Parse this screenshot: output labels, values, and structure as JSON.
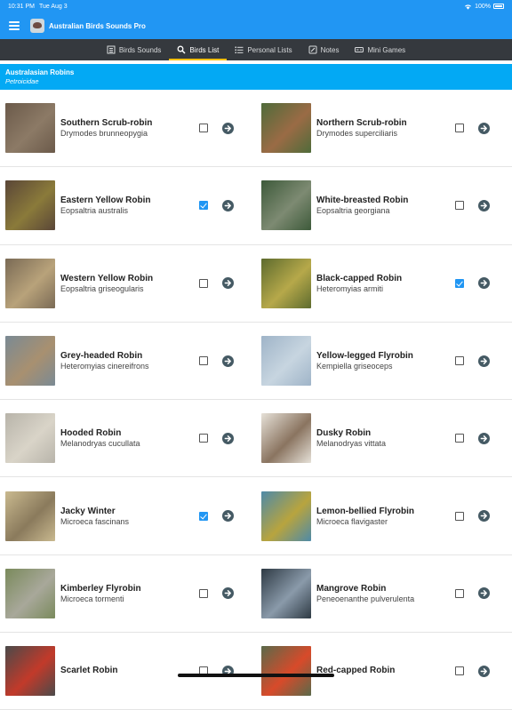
{
  "status_bar": {
    "time": "10:31 PM",
    "date": "Tue Aug 3",
    "battery": "100%"
  },
  "app": {
    "title": "Australian Birds Sounds Pro"
  },
  "tabs": [
    {
      "label": "Birds Sounds",
      "icon": "speaker-icon"
    },
    {
      "label": "Birds List",
      "icon": "search-icon",
      "active": true
    },
    {
      "label": "Personal Lists",
      "icon": "list-icon"
    },
    {
      "label": "Notes",
      "icon": "notes-icon"
    },
    {
      "label": "Mini Games",
      "icon": "gamepad-icon"
    }
  ],
  "section": {
    "family": "Australasian Robins",
    "latin": "Petroicidae"
  },
  "birds": [
    {
      "common": "Southern Scrub-robin",
      "species": "Drymodes brunneopygia",
      "checked": false,
      "photo": [
        "#6b5a4a",
        "#8c7a66"
      ]
    },
    {
      "common": "Northern Scrub-robin",
      "species": "Drymodes superciliaris",
      "checked": false,
      "photo": [
        "#4f6b3a",
        "#9a6b45"
      ]
    },
    {
      "common": "Eastern Yellow Robin",
      "species": "Eopsaltria australis",
      "checked": true,
      "photo": [
        "#5a4638",
        "#8a7a3a"
      ]
    },
    {
      "common": "White-breasted Robin",
      "species": "Eopsaltria georgiana",
      "checked": false,
      "photo": [
        "#3d5a3a",
        "#7d8a72"
      ]
    },
    {
      "common": "Western Yellow Robin",
      "species": "Eopsaltria griseogularis",
      "checked": false,
      "photo": [
        "#7a6a55",
        "#b8a27a"
      ]
    },
    {
      "common": "Black-capped Robin",
      "species": "Heteromyias armiti",
      "checked": true,
      "photo": [
        "#5d6b2e",
        "#b6a84a"
      ]
    },
    {
      "common": "Grey-headed Robin",
      "species": "Heteromyias cinereifrons",
      "checked": false,
      "photo": [
        "#7a8a94",
        "#a89070"
      ]
    },
    {
      "common": "Yellow-legged Flyrobin",
      "species": "Kempiella griseoceps",
      "checked": false,
      "photo": [
        "#9fb4c8",
        "#c7d5e0"
      ]
    },
    {
      "common": "Hooded Robin",
      "species": "Melanodryas cucullata",
      "checked": false,
      "photo": [
        "#b8b4aa",
        "#d9d4c8"
      ]
    },
    {
      "common": "Dusky Robin",
      "species": "Melanodryas vittata",
      "checked": false,
      "photo": [
        "#e6e1d8",
        "#8a7460"
      ]
    },
    {
      "common": "Jacky Winter",
      "species": "Microeca fascinans",
      "checked": true,
      "photo": [
        "#c9b98f",
        "#8a7a5c"
      ]
    },
    {
      "common": "Lemon-bellied Flyrobin",
      "species": "Microeca flavigaster",
      "checked": false,
      "photo": [
        "#4e8aa8",
        "#b8a43e"
      ]
    },
    {
      "common": "Kimberley Flyrobin",
      "species": "Microeca tormenti",
      "checked": false,
      "photo": [
        "#7a8a5c",
        "#a8a89a"
      ]
    },
    {
      "common": "Mangrove Robin",
      "species": "Peneoenanthe pulverulenta",
      "checked": false,
      "photo": [
        "#2e3a44",
        "#8a9aaa"
      ]
    },
    {
      "common": "Scarlet Robin",
      "species": "",
      "checked": false,
      "photo": [
        "#4a4a4a",
        "#c23a2a"
      ]
    },
    {
      "common": "Red-capped Robin",
      "species": "",
      "checked": false,
      "photo": [
        "#5a6a4a",
        "#d84a2a"
      ]
    }
  ],
  "colors": {
    "primary": "#2196f3",
    "section": "#03a9f4",
    "tab_bg": "#35393e",
    "tab_indicator": "#ffc107",
    "arrow": "#455a64"
  }
}
